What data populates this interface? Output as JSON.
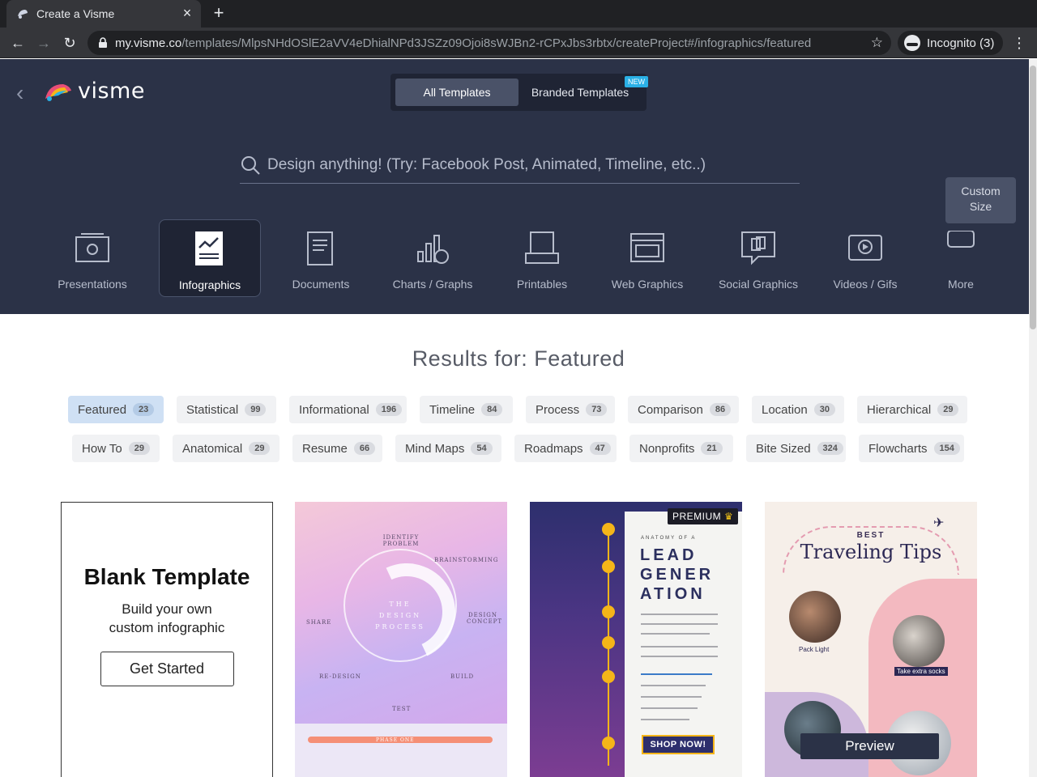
{
  "browser": {
    "tab_title": "Create a Visme",
    "url_host": "my.visme.co",
    "url_path": "/templates/MlpsNHdOSlE2aVV4eDhialNPd3JSZz09Ojoi8sWJBn2-rCPxJbs3rbtx/createProject#/infographics/featured",
    "incognito_label": "Incognito (3)"
  },
  "header": {
    "logo_text": "visme",
    "template_switch": {
      "all_label": "All Templates",
      "branded_label": "Branded Templates",
      "new_badge": "NEW"
    },
    "search_placeholder": "Design anything! (Try: Facebook Post, Animated, Timeline, etc..)",
    "categories": [
      {
        "label": "Presentations",
        "icon": "presentation-icon",
        "active": false
      },
      {
        "label": "Infographics",
        "icon": "infographic-icon",
        "active": true
      },
      {
        "label": "Documents",
        "icon": "document-icon",
        "active": false
      },
      {
        "label": "Charts / Graphs",
        "icon": "chart-icon",
        "active": false
      },
      {
        "label": "Printables",
        "icon": "printer-icon",
        "active": false
      },
      {
        "label": "Web Graphics",
        "icon": "web-graphic-icon",
        "active": false
      },
      {
        "label": "Social Graphics",
        "icon": "social-graphic-icon",
        "active": false
      },
      {
        "label": "Videos / Gifs",
        "icon": "video-icon",
        "active": false
      },
      {
        "label": "More",
        "icon": "more-icon",
        "active": false
      }
    ],
    "custom_size_line1": "Custom",
    "custom_size_line2": "Size"
  },
  "results": {
    "title": "Results for: Featured",
    "filters_row1": [
      {
        "label": "Featured",
        "count": "23",
        "active": true
      },
      {
        "label": "Statistical",
        "count": "99"
      },
      {
        "label": "Informational",
        "count": "196"
      },
      {
        "label": "Timeline",
        "count": "84"
      },
      {
        "label": "Process",
        "count": "73"
      },
      {
        "label": "Comparison",
        "count": "86"
      },
      {
        "label": "Location",
        "count": "30"
      },
      {
        "label": "Hierarchical",
        "count": "29"
      }
    ],
    "filters_row2": [
      {
        "label": "How To",
        "count": "29"
      },
      {
        "label": "Anatomical",
        "count": "29"
      },
      {
        "label": "Resume",
        "count": "66"
      },
      {
        "label": "Mind Maps",
        "count": "54"
      },
      {
        "label": "Roadmaps",
        "count": "47"
      },
      {
        "label": "Nonprofits",
        "count": "21"
      },
      {
        "label": "Bite Sized",
        "count": "324"
      },
      {
        "label": "Flowcharts",
        "count": "154"
      }
    ]
  },
  "cards": {
    "blank": {
      "title": "Blank Template",
      "line1": "Build your own",
      "line2": "custom infographic",
      "button": "Get Started"
    },
    "design_process": {
      "center_line1": "THE",
      "center_line2": "DESIGN",
      "center_line3": "PROCESS",
      "identify": "IDENTIFY PROBLEM",
      "brainstorming": "BRAINSTORMING",
      "design_concept": "DESIGN CONCEPT",
      "build": "BUILD",
      "test": "TEST",
      "redesign": "RE-DESIGN",
      "share": "SHARE",
      "phase": "PHASE ONE"
    },
    "lead_gen": {
      "premium": "PREMIUM",
      "anatomy": "ANATOMY OF A",
      "title_line1": "LEAD",
      "title_line2": "GENER",
      "title_line3": "ATION",
      "shop": "SHOP NOW!"
    },
    "travel": {
      "best": "BEST",
      "title": "Traveling Tips",
      "pack": "Pack Light",
      "socks": "Take extra socks",
      "preview": "Preview"
    }
  },
  "colors": {
    "hero_bg": "#2b3247",
    "accent_chip": "#cfe0f4"
  }
}
